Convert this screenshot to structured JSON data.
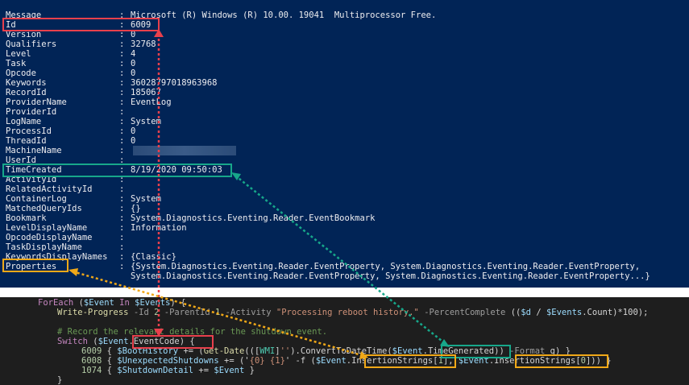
{
  "properties": [
    {
      "key": "Message",
      "value": "Microsoft (R) Windows (R) 10.00. 19041  Multiprocessor Free."
    },
    {
      "key": "Id",
      "value": "6009"
    },
    {
      "key": "Version",
      "value": "0"
    },
    {
      "key": "Qualifiers",
      "value": "32768"
    },
    {
      "key": "Level",
      "value": "4"
    },
    {
      "key": "Task",
      "value": "0"
    },
    {
      "key": "Opcode",
      "value": "0"
    },
    {
      "key": "Keywords",
      "value": "36028797018963968"
    },
    {
      "key": "RecordId",
      "value": "185067"
    },
    {
      "key": "ProviderName",
      "value": "EventLog"
    },
    {
      "key": "ProviderId",
      "value": ""
    },
    {
      "key": "LogName",
      "value": "System"
    },
    {
      "key": "ProcessId",
      "value": "0"
    },
    {
      "key": "ThreadId",
      "value": "0"
    },
    {
      "key": "MachineName",
      "value": ""
    },
    {
      "key": "UserId",
      "value": ""
    },
    {
      "key": "TimeCreated",
      "value": "8/19/2020 09:50:03"
    },
    {
      "key": "ActivityId",
      "value": ""
    },
    {
      "key": "RelatedActivityId",
      "value": ""
    },
    {
      "key": "ContainerLog",
      "value": "System"
    },
    {
      "key": "MatchedQueryIds",
      "value": "{}"
    },
    {
      "key": "Bookmark",
      "value": "System.Diagnostics.Eventing.Reader.EventBookmark"
    },
    {
      "key": "LevelDisplayName",
      "value": "Information"
    },
    {
      "key": "OpcodeDisplayName",
      "value": ""
    },
    {
      "key": "TaskDisplayName",
      "value": ""
    },
    {
      "key": "KeywordsDisplayNames",
      "value": "{Classic}"
    },
    {
      "key": "Properties",
      "value": "{System.Diagnostics.Eventing.Reader.EventProperty, System.Diagnostics.Eventing.Reader.EventProperty,"
    }
  ],
  "properties_continuation": "System.Diagnostics.Eventing.Reader.EventProperty, System.Diagnostics.Eventing.Reader.EventProperty...}",
  "separator": ":",
  "code": {
    "l1": {
      "kw1": "ForEach",
      "p1": " (",
      "v1": "$Event",
      "kw2": " In ",
      "v2": "$Events",
      "p2": ") {"
    },
    "l2": {
      "cmd": "Write-Progress",
      "pa": " -Id ",
      "n1": "2",
      "pb": " -ParentId ",
      "n2": "1",
      "pc": " -Activity ",
      "s": "\"Processing reboot history.\"",
      "pd": " -PercentComplete ",
      "e": "((",
      "v1": "$d",
      "e2": " / ",
      "v2": "$Events",
      "e3": ".Count)*100);"
    },
    "l3": {
      "cmt": "# Record the relevant details for the shutdown event."
    },
    "l4": {
      "kw": "Switch",
      "p1": " (",
      "v": "$Event",
      "p2": ".",
      "prop": "EventCode",
      "p3": ") {"
    },
    "l5": {
      "n": "6009",
      "p1": " { ",
      "v1": "$BootHistory",
      "p2": " += (",
      "cmd": "Get-Date",
      "p3": "(([",
      "t": "WMI",
      "p4": "]",
      "s": "''",
      "p5": ").ConvertToDateTime(",
      "v2": "$Event",
      "p6": ".",
      "prop": "TimeGenerated",
      "p7": ")) ",
      "pa": "-Format ",
      "arg": "g",
      "p8": ") }"
    },
    "l6": {
      "n": "6008",
      "p1": " { ",
      "v1": "$UnexpectedShutdowns",
      "p2": " += ('",
      "s": "{0} {1}",
      "p3": "' -f (",
      "v2": "$Event",
      "p4": ".",
      "prop1": "InsertionStrings",
      "p5": "[",
      "n1": "1",
      "p6": "], ",
      "v3": "$Event",
      "p7": ".",
      "prop2": "InsertionStrings",
      "p8": "[",
      "n2": "0",
      "p9": "])) }"
    },
    "l7": {
      "n": "1074",
      "p1": " { ",
      "v1": "$ShutdownDetail",
      "p2": " += ",
      "v2": "$Event",
      "p3": " }"
    },
    "l8": {
      "p": "}"
    }
  },
  "colors": {
    "ps_bg": "#012456",
    "editor_bg": "#1e1e1e",
    "red": "#e8404c",
    "teal": "#17a78a",
    "orange": "#f0a818"
  }
}
